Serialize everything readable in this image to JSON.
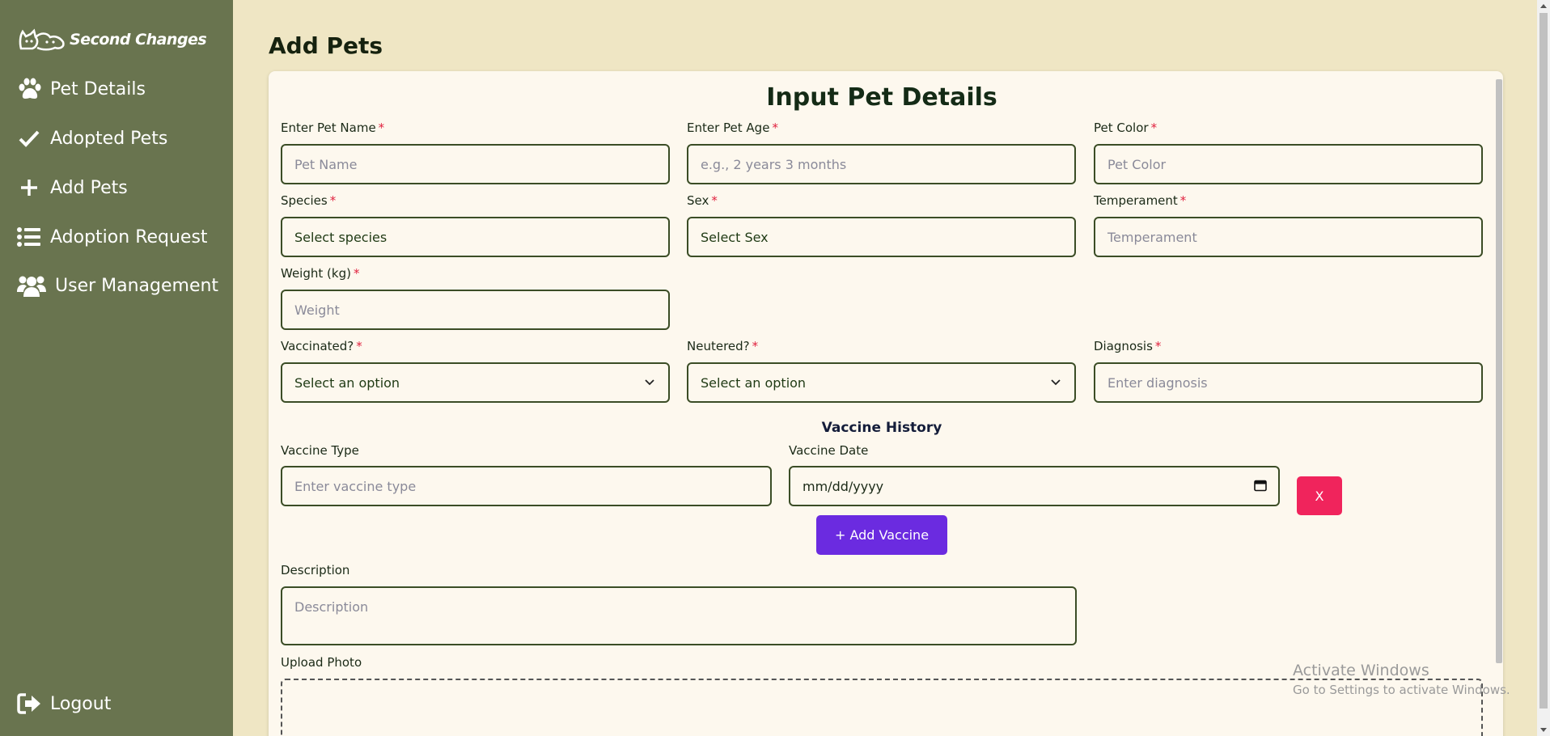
{
  "sidebar": {
    "brand": "Second Changes",
    "items": [
      {
        "label": "Pet Details",
        "icon": "paw-icon"
      },
      {
        "label": "Adopted Pets",
        "icon": "check-icon"
      },
      {
        "label": "Add Pets",
        "icon": "plus-icon"
      },
      {
        "label": "Adoption Request",
        "icon": "list-icon"
      },
      {
        "label": "User Management",
        "icon": "users-icon"
      }
    ],
    "logout": "Logout"
  },
  "page": {
    "title": "Add Pets"
  },
  "form": {
    "title": "Input Pet Details",
    "pet_name": {
      "label": "Enter Pet Name",
      "placeholder": "Pet Name"
    },
    "pet_age": {
      "label": "Enter Pet Age",
      "placeholder": "e.g., 2 years 3 months"
    },
    "pet_color": {
      "label": "Pet Color",
      "placeholder": "Pet Color"
    },
    "species": {
      "label": "Species",
      "value": "Select species"
    },
    "sex": {
      "label": "Sex",
      "value": "Select Sex"
    },
    "temperament": {
      "label": "Temperament",
      "placeholder": "Temperament"
    },
    "weight": {
      "label": "Weight (kg)",
      "placeholder": "Weight"
    },
    "vaccinated": {
      "label": "Vaccinated?",
      "value": "Select an option"
    },
    "neutered": {
      "label": "Neutered?",
      "value": "Select an option"
    },
    "diagnosis": {
      "label": "Diagnosis",
      "placeholder": "Enter diagnosis"
    },
    "required_mark": "*",
    "vaccine_history": {
      "title": "Vaccine History",
      "type_label": "Vaccine Type",
      "type_placeholder": "Enter vaccine type",
      "date_label": "Vaccine Date",
      "date_value": "mm/dd/yyyy",
      "remove_label": "X",
      "add_label": "+ Add Vaccine"
    },
    "description": {
      "label": "Description",
      "placeholder": "Description"
    },
    "upload": {
      "label": "Upload Photo"
    }
  },
  "watermark": {
    "line1": "Activate Windows",
    "line2": "Go to Settings to activate Windows."
  }
}
